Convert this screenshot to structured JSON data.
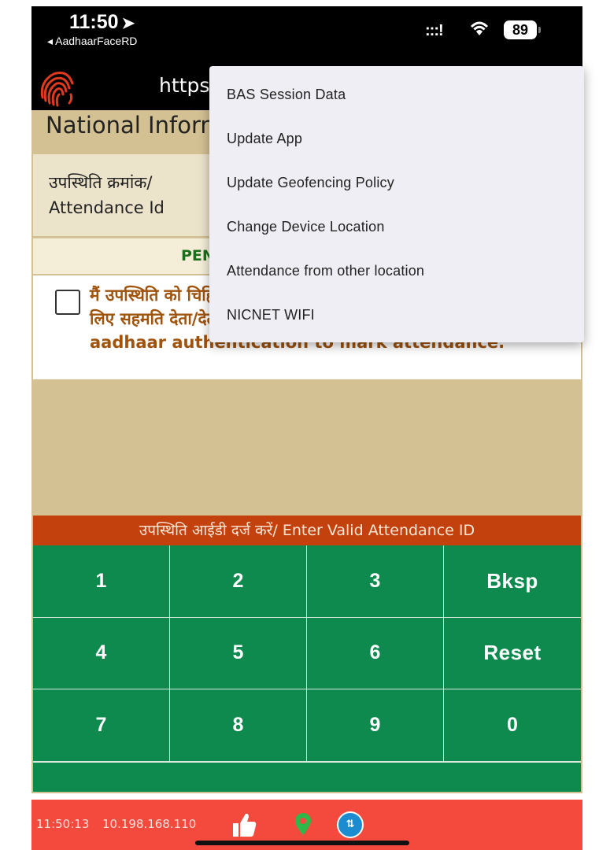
{
  "status_bar": {
    "time": "11:50",
    "back_app_label": "◂ AadhaarFaceRD",
    "battery": "89"
  },
  "app_bar": {
    "url": "https:"
  },
  "main": {
    "org_title": "National Informatics Centre",
    "attendance_label": "उपस्थिति क्रमांक/ Attendance Id",
    "pending_label": "PENDING",
    "consent_text": "मैं उपस्थिति को चिह्नित करने के लिए अपने बायोमेट्रिक आधार प्रमाणीकरण के लिए सहमति देता/देती हूँ। I give consent for my biometric aadhaar authentication to mark attendance.",
    "enter_banner": "उपस्थिति आईडी दर्ज करें/ Enter Valid Attendance ID"
  },
  "keypad": {
    "keys": [
      "1",
      "2",
      "3",
      "Bksp",
      "4",
      "5",
      "6",
      "Reset",
      "7",
      "8",
      "9",
      "0"
    ]
  },
  "bottom_bar": {
    "time": "11:50:13",
    "ip": "10.198.168.110"
  },
  "menu": {
    "items": [
      "BAS Session Data",
      "Update App",
      "Update Geofencing Policy",
      "Change Device Location",
      "Attendance from other location",
      "NICNET WIFI"
    ]
  },
  "colors": {
    "keypad_green": "#0f8a4e",
    "banner_orange": "#c2410c",
    "bottom_red": "#f34a3d",
    "content_tan": "#d3c194"
  }
}
